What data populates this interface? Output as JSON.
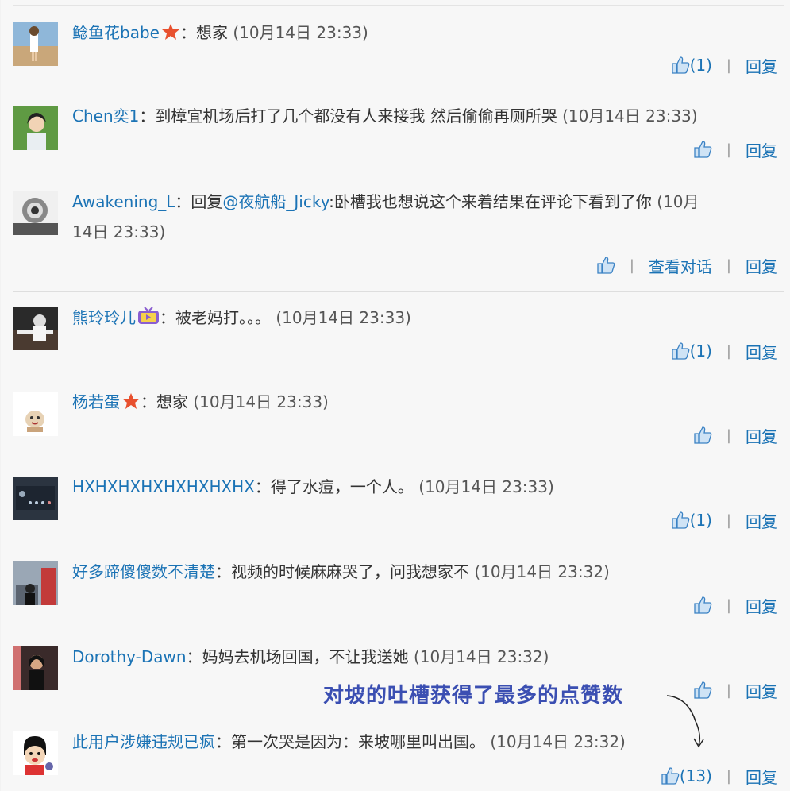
{
  "annotation": "对坡的吐槽获得了最多的点赞数",
  "labels": {
    "reply": "回复",
    "view_conversation": "查看对话",
    "separator": "|"
  },
  "colors": {
    "link": "#1b73b5",
    "annotation": "#3b4fb2"
  },
  "comments": [
    {
      "user": "鲶鱼花babe",
      "badge": "star-badge-icon",
      "sep": "：",
      "text": "想家",
      "time": "(10月14日 23:33)",
      "likes": "(1)"
    },
    {
      "user": "Chen奕1",
      "sep": "：",
      "text": "到樟宜机场后打了几个都没有人来接我 然后偷偷再厕所哭",
      "time": "(10月14日 23:33)",
      "likes": ""
    },
    {
      "user": "Awakening_L",
      "sep": "：",
      "text_prefix": "回复",
      "mention": "@夜航船_Jicky",
      "text": ":卧槽我也想说这个来着结果在评论下看到了你",
      "time_a": "(10月",
      "time_b": "14日 23:33)",
      "likes": ""
    },
    {
      "user": "熊玲玲儿",
      "badge": "tv-badge-icon",
      "sep": "：",
      "text": "被老妈打。。。",
      "time": "(10月14日 23:33)",
      "likes": "(1)"
    },
    {
      "user": "杨若蛋",
      "badge": "star-badge-icon",
      "sep": "：",
      "text": "想家",
      "time": "(10月14日 23:33)",
      "likes": ""
    },
    {
      "user": "HXHXHXHXHXHXHXHX",
      "sep": "：",
      "text": "得了水痘，一个人。",
      "time": "(10月14日 23:33)",
      "likes": "(1)"
    },
    {
      "user": "好多蹄傻傻数不清楚",
      "sep": "：",
      "text": "视频的时候麻麻哭了，问我想家不",
      "time": "(10月14日 23:32)",
      "likes": ""
    },
    {
      "user": "Dorothy-Dawn",
      "sep": "：",
      "text": "妈妈去机场回国，不让我送她",
      "time": "(10月14日 23:32)",
      "likes": ""
    },
    {
      "user": "此用户涉嫌违规已疯",
      "sep": "：",
      "text": "第一次哭是因为：来坡哪里叫出国。",
      "time": "(10月14日 23:32)",
      "likes": "(13)"
    }
  ]
}
